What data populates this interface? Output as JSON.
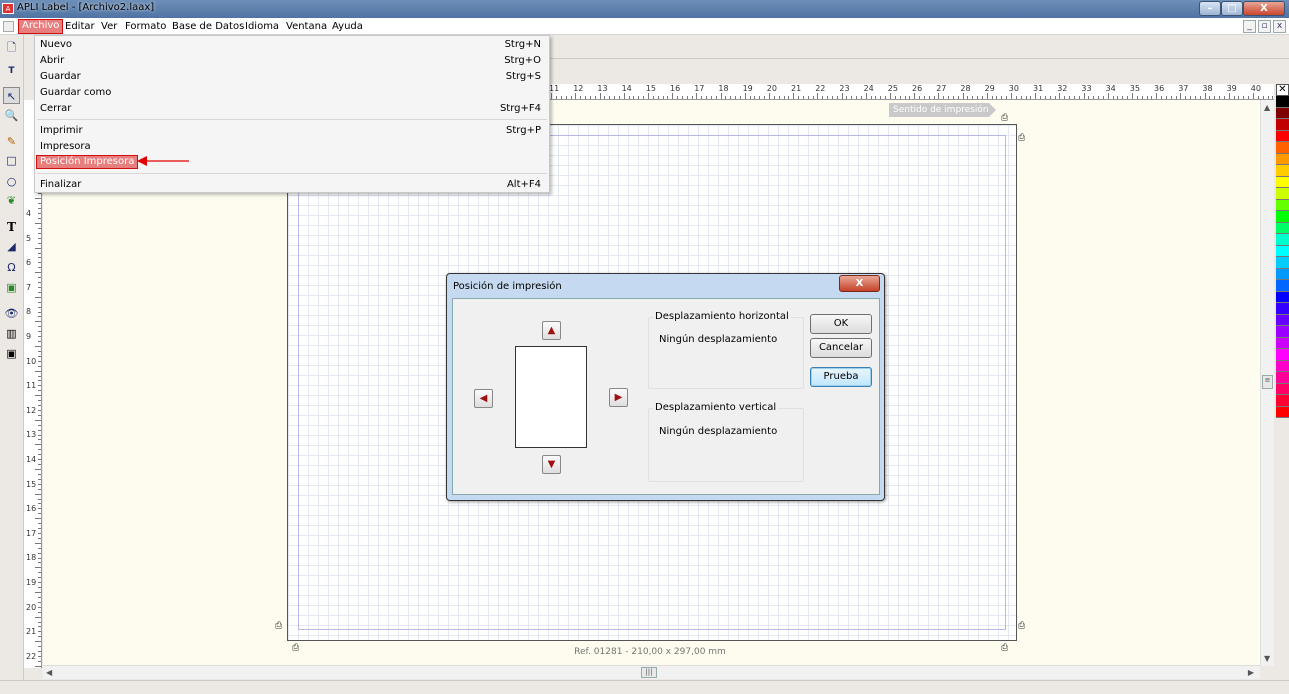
{
  "window": {
    "title": "APLI Label - [Archivo2.laax]",
    "min": "–",
    "max": "□",
    "close": "X"
  },
  "menubar": {
    "items": [
      "Archivo",
      "Editar",
      "Ver",
      "Formato",
      "Base de Datos",
      "Idioma",
      "Ventana",
      "Ayuda"
    ],
    "mdi": {
      "min": "_",
      "restore": "▫",
      "close": "x"
    }
  },
  "file_menu": {
    "items": [
      {
        "label": "Nuevo",
        "shortcut": "Strg+N"
      },
      {
        "label": "Abrir",
        "shortcut": "Strg+O"
      },
      {
        "label": "Guardar",
        "shortcut": "Strg+S"
      },
      {
        "label": "Guardar como",
        "shortcut": ""
      },
      {
        "label": "Cerrar",
        "shortcut": "Strg+F4"
      },
      {
        "label": "Imprimir",
        "shortcut": "Strg+P"
      },
      {
        "label": "Impresora",
        "shortcut": ""
      },
      {
        "label": "Posición Impresora",
        "shortcut": ""
      },
      {
        "label": "Finalizar",
        "shortcut": "Alt+F4"
      }
    ]
  },
  "ruler": {
    "h_numbers": [
      "11",
      "12",
      "13",
      "14",
      "15",
      "16",
      "17",
      "18",
      "19",
      "20",
      "21",
      "22",
      "23",
      "24",
      "25",
      "26",
      "27",
      "28",
      "29",
      "30",
      "31",
      "32",
      "33",
      "34",
      "35",
      "36",
      "37",
      "38",
      "39",
      "40"
    ],
    "v_numbers": [
      "4",
      "5",
      "6",
      "7",
      "8",
      "9",
      "10",
      "11",
      "12",
      "13",
      "14",
      "15",
      "16",
      "17",
      "18",
      "19",
      "20",
      "21",
      "22"
    ]
  },
  "canvas": {
    "print_direction": "Sentido de impresión",
    "reference": "Ref. 01281 - 210,00 x 297,00 mm"
  },
  "dialog": {
    "title": "Posición de impresión",
    "close": "X",
    "horizontal_group": "Desplazamiento horizontal",
    "horizontal_value": "Ningún desplazamiento",
    "vertical_group": "Desplazamiento vertical",
    "vertical_value": "Ningún desplazamiento",
    "ok": "OK",
    "cancel": "Cancelar",
    "test": "Prueba"
  },
  "palette": {
    "colors": [
      "#000000",
      "#7f0000",
      "#c00000",
      "#ff0000",
      "#ff6000",
      "#ff9900",
      "#ffcc00",
      "#ffff00",
      "#ccff00",
      "#66ff00",
      "#00ff00",
      "#00ff66",
      "#00ffcc",
      "#00ffff",
      "#00ccff",
      "#0099ff",
      "#0066ff",
      "#0000ff",
      "#3300ff",
      "#6600ff",
      "#9900ff",
      "#cc00ff",
      "#ff00ff",
      "#ff00cc",
      "#ff0099",
      "#ff0066",
      "#ff0033",
      "#ff0000"
    ]
  },
  "colors": {
    "highlight": "#e87f7f",
    "highlight_border": "#d01010",
    "arrow": "#e00000"
  }
}
